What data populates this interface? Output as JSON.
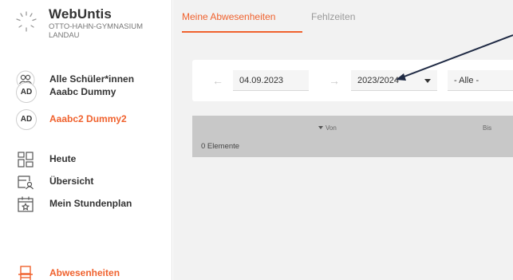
{
  "brand": {
    "name": "WebUntis",
    "school_line1": "OTTO-HAHN-GYMNASIUM",
    "school_line2": "LANDAU"
  },
  "sidebar": {
    "students": [
      {
        "label": "Alle Schüler*innen",
        "icon": "group-icon"
      },
      {
        "label": "Aaabc Dummy",
        "avatar": "AD"
      },
      {
        "label": "Aaabc2 Dummy2",
        "avatar": "AD",
        "active": true
      }
    ],
    "nav": [
      {
        "label": "Heute",
        "icon": "dashboard-icon"
      },
      {
        "label": "Übersicht",
        "icon": "overview-icon"
      },
      {
        "label": "Mein Stundenplan",
        "icon": "calendar-icon"
      },
      {
        "label": "Abwesenheiten",
        "icon": "absence-icon",
        "active": true
      }
    ]
  },
  "tabs": [
    {
      "label": "Meine Abwesenheiten",
      "active": true
    },
    {
      "label": "Fehlzeiten",
      "active": false
    }
  ],
  "filters": {
    "date": "04.09.2023",
    "school_year": "2023/2024",
    "status": "- Alle -"
  },
  "table": {
    "columns": [
      "Von",
      "Bis"
    ],
    "sort_column": "Von",
    "count_text": "0 Elemente"
  },
  "colors": {
    "accent": "#f0622e",
    "sidebar_bg": "#ffffff",
    "main_bg": "#f2f2f2",
    "table_header_bg": "#c8c8c8",
    "annotation": "#1f2a44"
  }
}
